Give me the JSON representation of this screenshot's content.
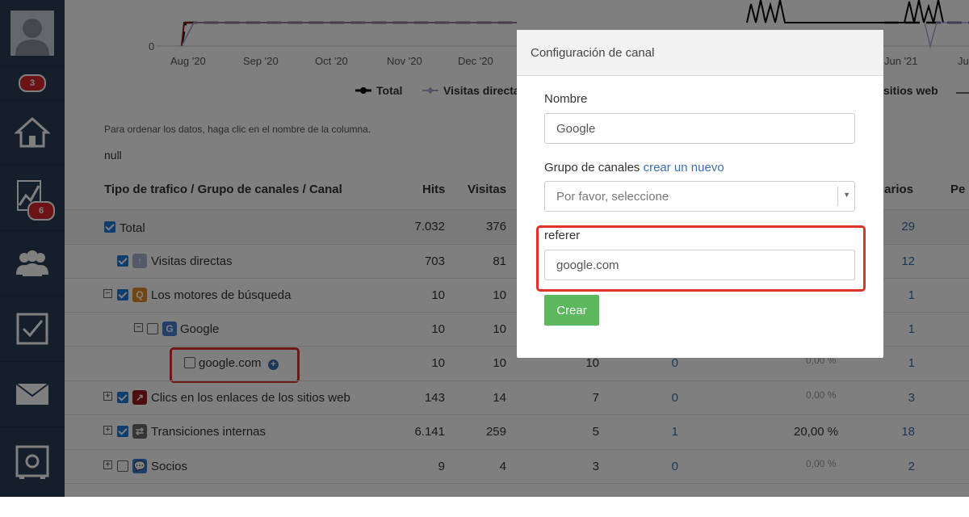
{
  "sidebar": {
    "badges": {
      "top": "3",
      "chart": "6"
    }
  },
  "chart": {
    "y_zero": "0",
    "months": [
      "Aug '20",
      "Sep '20",
      "Oct '20",
      "Nov '20",
      "Dec '20",
      "Jun '21",
      "Ju"
    ],
    "legend": [
      "Total",
      "Visitas directa",
      "sitios web"
    ]
  },
  "table": {
    "note": "Para ordenar los datos, haga clic en el nombre de la columna.",
    "null_text": "null",
    "headers": {
      "name": "Tipo de trafico / Grupo de canales / Canal",
      "hits": "Hits",
      "visits": "Visitas",
      "users": "uarios",
      "pe": "Pe"
    },
    "rows": [
      {
        "name": "Total",
        "hits": "7.032",
        "visits": "376",
        "c3": "",
        "c4": "",
        "pct": "",
        "users": "29"
      },
      {
        "name": "Visitas directas",
        "hits": "703",
        "visits": "81",
        "c3": "",
        "c4": "",
        "pct": "",
        "users": "12"
      },
      {
        "name": "Los motores de búsqueda",
        "hits": "10",
        "visits": "10",
        "c3": "",
        "c4": "",
        "pct": "",
        "users": "1"
      },
      {
        "name": "Google",
        "hits": "10",
        "visits": "10",
        "c3": "",
        "c4": "",
        "pct": "",
        "users": "1"
      },
      {
        "name": "google.com",
        "hits": "10",
        "visits": "10",
        "c3": "10",
        "c4": "0",
        "pct": "0,00 %",
        "users": "1"
      },
      {
        "name": "Clics en los enlaces de los sitios web",
        "hits": "143",
        "visits": "14",
        "c3": "7",
        "c4": "0",
        "pct": "0,00 %",
        "users": "3"
      },
      {
        "name": "Transiciones internas",
        "hits": "6.141",
        "visits": "259",
        "c3": "5",
        "c4": "1",
        "pct": "20,00 %",
        "users": "18"
      },
      {
        "name": "Socios",
        "hits": "9",
        "visits": "4",
        "c3": "3",
        "c4": "0",
        "pct": "0,00 %",
        "users": "2"
      }
    ]
  },
  "modal": {
    "title": "Configuración de canal",
    "nombre_label": "Nombre",
    "nombre_value": "Google",
    "grupo_label": "Grupo de canales",
    "grupo_link": "crear un nuevo",
    "grupo_placeholder": "Por favor, seleccione",
    "referer_label": "referer",
    "referer_value": "google.com",
    "crear_label": "Crear"
  }
}
